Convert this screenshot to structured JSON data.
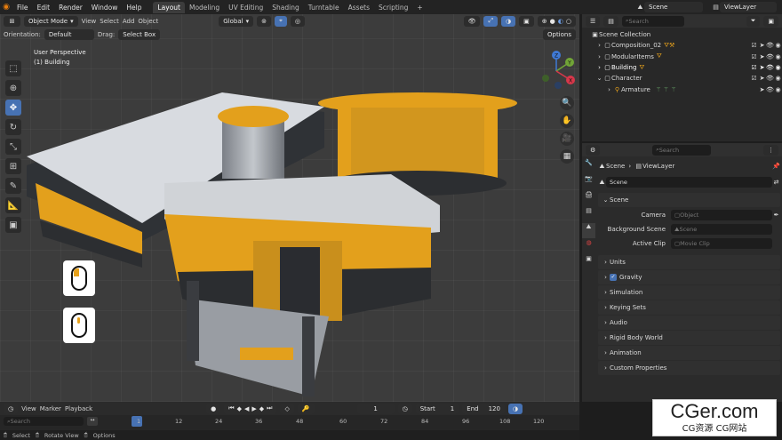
{
  "menu": [
    "File",
    "Edit",
    "Render",
    "Window",
    "Help"
  ],
  "workspaces": [
    "Layout",
    "Modeling",
    "UV Editing",
    "Shading",
    "Turntable",
    "Assets",
    "Scripting"
  ],
  "workspace_add": "+",
  "scene_selector": "Scene",
  "viewlayer_selector": "ViewLayer",
  "viewport": {
    "mode": "Object Mode",
    "menus": [
      "View",
      "Select",
      "Add",
      "Object"
    ],
    "transform": "Global",
    "orientation_label": "Orientation:",
    "orientation_value": "Default",
    "drag_label": "Drag:",
    "drag_value": "Select Box",
    "options": "Options",
    "overlay_title": "User Perspective",
    "overlay_subtitle": "(1) Building",
    "gizmo": {
      "z": "Z",
      "y": "Y",
      "x": "X"
    }
  },
  "outliner": {
    "search_placeholder": "Search",
    "root": "Scene Collection",
    "items": [
      {
        "name": "Composition_02",
        "indent": 1
      },
      {
        "name": "ModularItems",
        "indent": 1
      },
      {
        "name": "Building",
        "indent": 1
      },
      {
        "name": "Character",
        "indent": 1
      },
      {
        "name": "Armature",
        "indent": 2
      }
    ]
  },
  "properties": {
    "search_placeholder": "Search",
    "breadcrumb": [
      "Scene",
      "ViewLayer"
    ],
    "datablock": "Scene",
    "panel_title": "Scene",
    "fields": [
      {
        "label": "Camera",
        "placeholder": "Object"
      },
      {
        "label": "Background Scene",
        "placeholder": "Scene"
      },
      {
        "label": "Active Clip",
        "placeholder": "Movie Clip"
      }
    ],
    "sections": [
      "Units",
      "Gravity",
      "Simulation",
      "Keying Sets",
      "Audio",
      "Rigid Body World",
      "Animation",
      "Custom Properties"
    ]
  },
  "timeline": {
    "menus": [
      "View",
      "Marker",
      "Playback"
    ],
    "current_frame": "1",
    "start_label": "Start",
    "start": "1",
    "end_label": "End",
    "end": "120",
    "search_placeholder": "Search",
    "ticks": [
      "1",
      "12",
      "24",
      "36",
      "48",
      "60",
      "72",
      "84",
      "96",
      "108",
      "120"
    ]
  },
  "status": [
    "Select",
    "Rotate View",
    "Options"
  ],
  "watermark": {
    "main": "CGer.com",
    "sub": "CG资源 CG网站"
  },
  "colors": {
    "accent": "#4772b3",
    "orange": "#e8a21c",
    "axis_x": "#d7374a",
    "axis_y": "#71a437",
    "axis_z": "#3f79d5"
  }
}
